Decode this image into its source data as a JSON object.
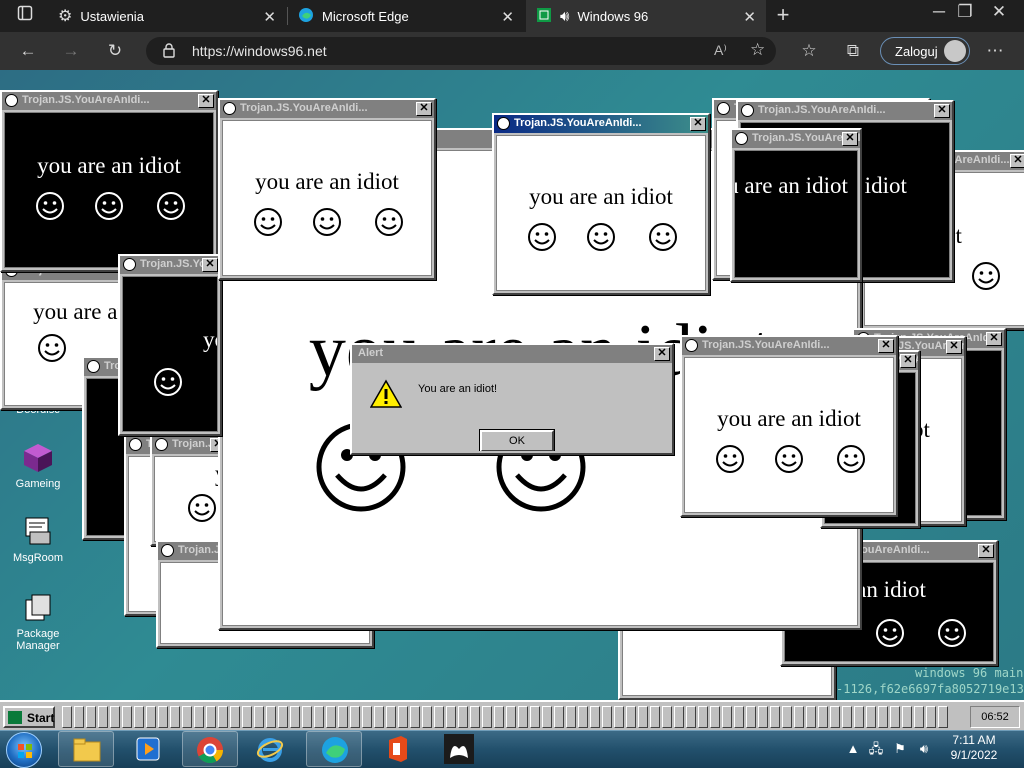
{
  "browser": {
    "tabs": [
      {
        "label": "Ustawienia",
        "icon": "gear-icon"
      },
      {
        "label": "Microsoft Edge",
        "icon": "edge-icon"
      },
      {
        "label": "Windows 96",
        "icon": "windows96-icon"
      }
    ],
    "url": "https://windows96.net",
    "signin_label": "Zaloguj"
  },
  "desktop": {
    "icons": [
      {
        "label": "Doordisc"
      },
      {
        "label": "Gameing"
      },
      {
        "label": "MsgRoom"
      },
      {
        "label": "Package Manager"
      }
    ],
    "terminal_lines": [
      "windows 96 main",
      "-1126,f62e6697fa8052719e13"
    ]
  },
  "popup": {
    "title": "Trojan.JS.YouAreAnIdi...",
    "text": "you are an idiot"
  },
  "background_window": {
    "text": "you are an idiot"
  },
  "alert": {
    "title": "Alert",
    "message": "You are an idiot!",
    "ok_label": "OK"
  },
  "w96_taskbar": {
    "start_label": "Start",
    "clock": "06:52"
  },
  "os_taskbar": {
    "time": "7:11 AM",
    "date": "9/1/2022"
  },
  "colors": {
    "edge_tabbar": "#1f1f1f",
    "desktop_teal": "#2f8b93",
    "win96_gray": "#c0c0c0",
    "active_title": "#0a2a85"
  }
}
